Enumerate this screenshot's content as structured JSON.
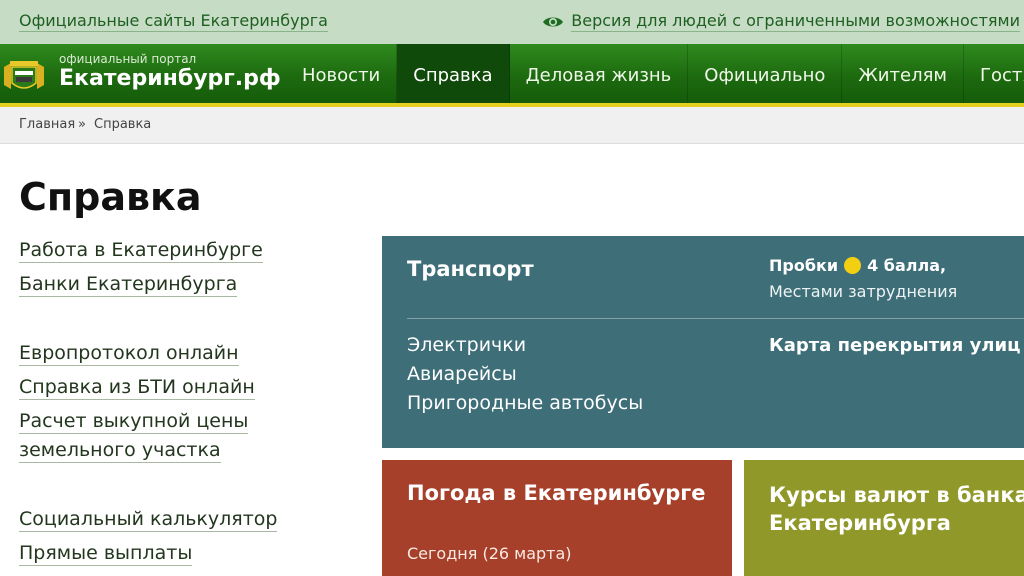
{
  "topbar": {
    "official_sites": "Официальные сайты Екатеринбурга",
    "accessibility": "Версия для людей с ограниченными возможностями"
  },
  "header": {
    "portal_small": "официальный портал",
    "portal_name": "Екатеринбург.рф"
  },
  "nav": {
    "items": [
      "Новости",
      "Справка",
      "Деловая жизнь",
      "Официально",
      "Жителям",
      "Гостям"
    ],
    "active": "Справка"
  },
  "breadcrumb": {
    "home": "Главная",
    "separator": "»",
    "current": "Справка"
  },
  "page": {
    "title": "Справка"
  },
  "sidebar": {
    "links": [
      "Работа в Екатеринбурге",
      "Банки Екатеринбурга",
      "Европротокол онлайн",
      "Справка из БТИ онлайн",
      "Расчет выкупной цены",
      "земельного участка",
      "Социальный калькулятор",
      "Прямые выплаты"
    ]
  },
  "transport": {
    "title": "Транспорт",
    "traffic_label": "Пробки",
    "traffic_value": "4 балла,",
    "traffic_status": "Местами затруднения",
    "links": [
      "Электрички",
      "Авиарейсы",
      "Пригородные автобусы"
    ],
    "map_link": "Карта перекрытия улиц"
  },
  "weather": {
    "title": "Погода в Екатеринбурге",
    "today": "Сегодня (26 марта)"
  },
  "rates": {
    "title_line1": "Курсы валют в банках",
    "title_line2": "Екатеринбурга"
  },
  "colors": {
    "topbar": "#c6dcc4",
    "nav_green": "#1d6a0f",
    "accent_yellow": "#e6cf1f",
    "transport": "#3e6e78",
    "weather": "#a6402a",
    "rates": "#8f9828",
    "traffic_dot": "#f3cf12"
  }
}
